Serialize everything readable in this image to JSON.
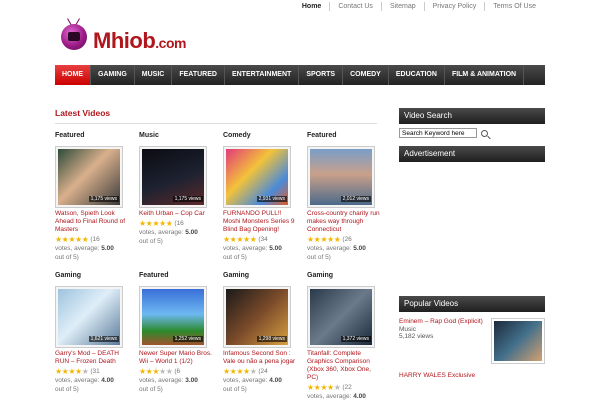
{
  "toplinks": [
    "Home",
    "Contact Us",
    "Sitemap",
    "Privacy Policy",
    "Terms Of Use"
  ],
  "logo": {
    "brand": "Mhiob",
    "suffix": ".com"
  },
  "nav": [
    "HOME",
    "GAMING",
    "MUSIC",
    "FEATURED",
    "ENTERTAINMENT",
    "SPORTS",
    "COMEDY",
    "EDUCATION",
    "FILM & ANIMATION"
  ],
  "main": {
    "title": "Latest Videos"
  },
  "videos": [
    {
      "cat": "Featured",
      "views": "1,175 views",
      "title": "Watson, Spieth Look Ahead to Final Round of Masters",
      "stars": 5,
      "cnt": "(16",
      "meta1": "votes, average:",
      "avg": "5.00",
      "meta2": "out of 5)",
      "thumb": "linear-gradient(135deg,#2e4a3a 0%,#d9b08c 45%,#3a3a3a 100%)"
    },
    {
      "cat": "Music",
      "views": "1,175 views",
      "title": "Keith Urban – Cop Car",
      "stars": 5,
      "cnt": "(16",
      "meta1": "votes, average:",
      "avg": "5.00",
      "meta2": "out of 5)",
      "thumb": "linear-gradient(160deg,#0b0b12 0%,#1d2231 55%,#5e2a2a 100%)"
    },
    {
      "cat": "Comedy",
      "views": "2,931 views",
      "title": "FURNANDO PULL!! Moshi Monsters Series 9 Blind Bag Opening!",
      "stars": 5,
      "cnt": "(34",
      "meta1": "votes, average:",
      "avg": "5.00",
      "meta2": "out of 5)",
      "thumb": "linear-gradient(135deg,#e23a7a 0%,#f3c23a 40%,#4a8ad8 75%,#e05a2a 100%)"
    },
    {
      "cat": "Featured",
      "views": "2,012 views",
      "title": "Cross-country charity run makes way through Connecticut",
      "stars": 5,
      "cnt": "(26",
      "meta1": "votes, average:",
      "avg": "5.00",
      "meta2": "out of 5)",
      "thumb": "linear-gradient(180deg,#7a9ec8 0%,#c9a08a 45%,#4b6a8a 100%)"
    },
    {
      "cat": "Gaming",
      "views": "1,621 views",
      "title": "Garry's Mod – DEATH RUN – Frozen Death",
      "stars": 4,
      "cnt": "(31",
      "meta1": "votes, average:",
      "avg": "4.00",
      "meta2": "out of 5)",
      "thumb": "linear-gradient(135deg,#9ec3de 0%,#dfeef8 45%,#5b7a9a 100%)"
    },
    {
      "cat": "Featured",
      "views": "1,252 views",
      "title": "Newer Super Mario Bros. Wii – World 1 (1/2)",
      "stars": 3,
      "cnt": "(6",
      "meta1": "votes, average:",
      "avg": "3.00",
      "meta2": "out of 5)",
      "thumb": "linear-gradient(180deg,#3a6fd8 0%,#6db8f0 45%,#2c8a2c 75%,#a0522d 100%)"
    },
    {
      "cat": "Gaming",
      "views": "1,298 views",
      "title": "Infamous Second Son : Vale ou não a pena jogar",
      "stars": 4,
      "cnt": "(24",
      "meta1": "votes, average:",
      "avg": "4.00",
      "meta2": "out of 5)",
      "thumb": "linear-gradient(135deg,#1a1a1a 0%,#7a4a2a 50%,#d8a040 100%)"
    },
    {
      "cat": "Gaming",
      "views": "1,372 views",
      "title": "Titanfall: Complete Graphics Comparison (Xbox 360, Xbox One, PC)",
      "stars": 4,
      "cnt": "(22",
      "meta1": "votes, average:",
      "avg": "4.00",
      "meta2": "out of 5)",
      "thumb": "linear-gradient(135deg,#2a3a4a 0%,#6a7a8a 50%,#1a2a3a 100%)"
    }
  ],
  "sidebar": {
    "search_title": "Video Search",
    "search_placeholder": "Search Keyword here",
    "ad_title": "Advertisement",
    "popular_title": "Popular Videos",
    "popular": {
      "title": "Eminem – Rap God (Explicit)",
      "cat": "Music",
      "views": "5,182 views",
      "next": "HARRY WALES Exclusive"
    }
  },
  "colors": {
    "accent": "#b0161c",
    "nav_bg": "#222222",
    "star": "#f2b705"
  }
}
